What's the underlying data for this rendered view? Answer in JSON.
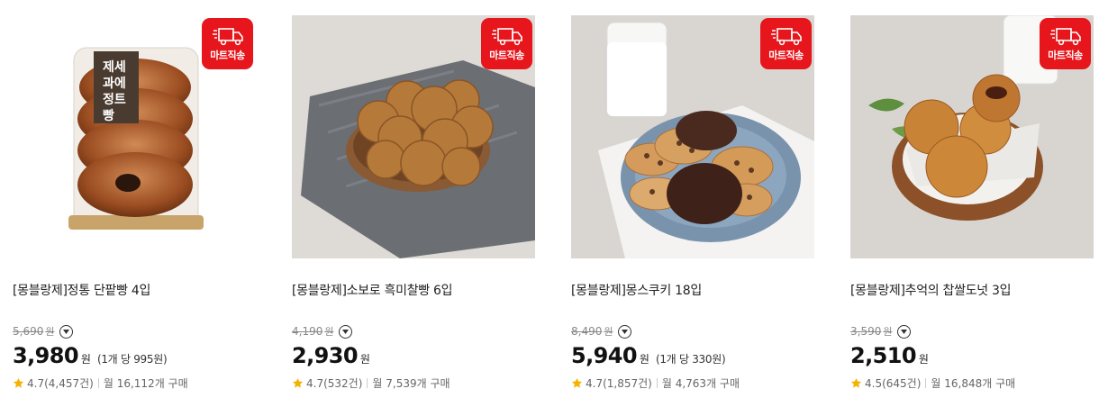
{
  "badge_label": "마트직송",
  "colors": {
    "badge": "#e6161c",
    "star": "#f5b301"
  },
  "products": [
    {
      "title": "[몽블랑제]정통 단팥빵 4입",
      "original_price": "5,690",
      "original_unit": "원",
      "price": "3,980",
      "price_unit": "원",
      "unit_price": "(1개 당 995원)",
      "rating": "4.7",
      "review_count": "(4,457건)",
      "monthly_sales": "월 16,112개 구매",
      "image": "red-bean-bread-pack"
    },
    {
      "title": "[몽블랑제]소보로 흑미찰빵 6입",
      "original_price": "4,190",
      "original_unit": "원",
      "price": "2,930",
      "price_unit": "원",
      "unit_price": "",
      "rating": "4.7",
      "review_count": "(532건)",
      "monthly_sales": "월 7,539개 구매",
      "image": "soboro-bread-on-plate"
    },
    {
      "title": "[몽블랑제]몽스쿠키 18입",
      "original_price": "8,490",
      "original_unit": "원",
      "price": "5,940",
      "price_unit": "원",
      "unit_price": "(1개 당 330원)",
      "rating": "4.7",
      "review_count": "(1,857건)",
      "monthly_sales": "월 4,763개 구매",
      "image": "cookies-with-milk"
    },
    {
      "title": "[몽블랑제]추억의 찹쌀도넛 3입",
      "original_price": "3,590",
      "original_unit": "원",
      "price": "2,510",
      "price_unit": "원",
      "unit_price": "",
      "rating": "4.5",
      "review_count": "(645건)",
      "monthly_sales": "월 16,848개 구매",
      "image": "rice-donuts-in-bowl"
    }
  ]
}
